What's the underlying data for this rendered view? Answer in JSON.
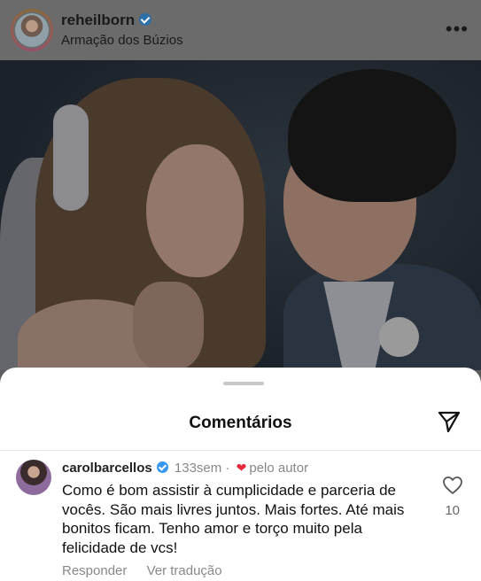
{
  "post": {
    "username": "reheilborn",
    "location": "Armação dos Búzios",
    "more_glyph": "•••"
  },
  "sheet": {
    "title": "Comentários"
  },
  "comment": {
    "username": "carolbarcellos",
    "time": "133sem",
    "separator": "·",
    "heart_glyph": "❤",
    "liked_by_author": "pelo autor",
    "text": "Como é bom assistir à cumplicidade e parceria de vocês. São mais livres juntos. Mais fortes. Até mais bonitos ficam. Tenho amor  e torço muito pela felicidade de vcs!",
    "like_count": "10",
    "reply_label": "Responder",
    "translate_label": "Ver tradução"
  },
  "icons": {
    "verified": "verified-badge-icon",
    "more": "more-options-icon",
    "share": "paper-plane-icon",
    "like": "heart-outline-icon"
  },
  "colors": {
    "verified_blue": "#3897f0",
    "heart_red": "#e8283c",
    "secondary_text": "#888888",
    "dim_overlay": "#5c5c5c"
  }
}
